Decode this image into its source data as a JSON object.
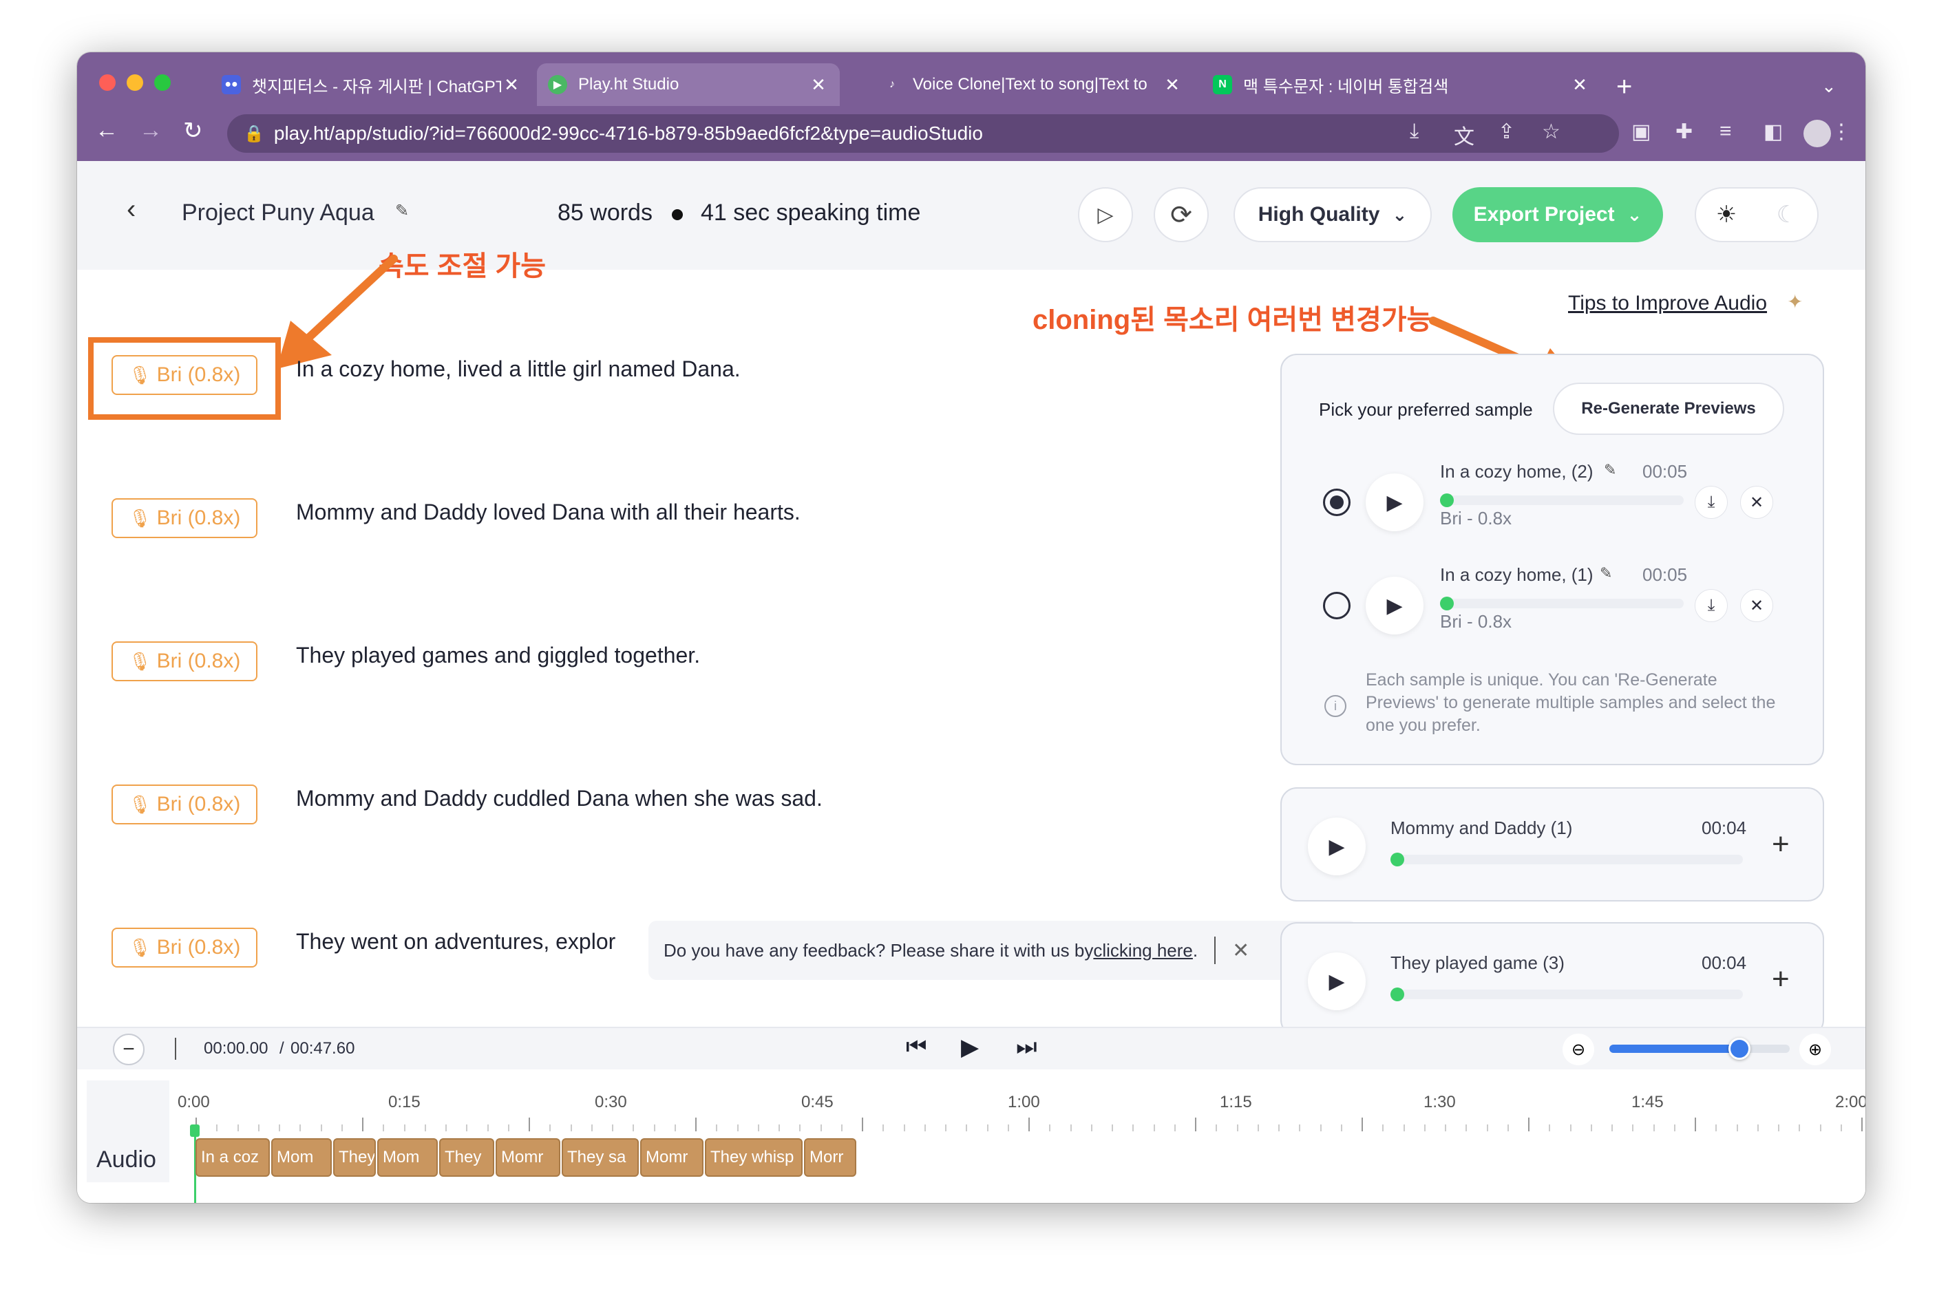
{
  "browser": {
    "tabs": [
      {
        "label": "챗지피터스 - 자유 게시판 | ChatGPT"
      },
      {
        "label": "Play.ht Studio"
      },
      {
        "label": "Voice Clone|Text to song|Text to"
      },
      {
        "label": "맥 특수문자 : 네이버 통합검색"
      }
    ],
    "url": "play.ht/app/studio/?id=766000d2-99cc-4716-b879-85b9aed6fcf2&type=audioStudio"
  },
  "header": {
    "project_name": "Project Puny Aqua",
    "word_count": "85 words",
    "speaking_time": "41 sec speaking time",
    "quality_label": "High Quality",
    "export_label": "Export Project"
  },
  "annotations": {
    "speed": "속도 조절 가능",
    "cloning": "cloning된 목소리 여러번 변경가능"
  },
  "tips_link": "Tips to Improve Audio",
  "paragraphs": [
    {
      "voice": "Bri (0.8x)",
      "text": "In a cozy home, lived a little girl named Dana."
    },
    {
      "voice": "Bri (0.8x)",
      "text": "Mommy and Daddy loved Dana with all their hearts."
    },
    {
      "voice": "Bri (0.8x)",
      "text": "They played games and giggled together."
    },
    {
      "voice": "Bri (0.8x)",
      "text": "Mommy and Daddy cuddled Dana when she was sad."
    },
    {
      "voice": "Bri (0.8x)",
      "text": "They went on adventures, explor"
    }
  ],
  "feedback": {
    "text": "Do you have any feedback? Please share it with us by ",
    "link": "clicking here",
    "end": "."
  },
  "preview_panel": {
    "heading": "Pick your preferred sample",
    "regenerate_label": "Re-Generate Previews",
    "samples": [
      {
        "title": "In a cozy home, (2)",
        "duration": "00:05",
        "voice": "Bri - 0.8x",
        "selected": true
      },
      {
        "title": "In a cozy home, (1)",
        "duration": "00:05",
        "voice": "Bri - 0.8x",
        "selected": false
      }
    ],
    "info": "Each sample is unique. You can 'Re-Generate Previews' to generate multiple samples and select the one you prefer."
  },
  "other_previews": [
    {
      "title": "Mommy and Daddy (1)",
      "duration": "00:04"
    },
    {
      "title": "They played game (3)",
      "duration": "00:04"
    }
  ],
  "player": {
    "current": "00:00.00",
    "separator": "/",
    "total": "00:47.60",
    "zoom_level": 0.72
  },
  "timeline": {
    "ticks": [
      "0:00",
      "0:15",
      "0:30",
      "0:45",
      "1:00",
      "1:15",
      "1:30",
      "1:45",
      "2:00"
    ],
    "track_label": "Audio",
    "clips": [
      "In a coz",
      "Mom",
      "They",
      "Mom",
      "They ",
      "Momr",
      "They sa",
      "Momr",
      "They whisp",
      "Morr"
    ]
  },
  "colors": {
    "chrome": "#7b5d96",
    "export_green": "#58d487",
    "voice_orange": "#f0a24c",
    "annotation_orange": "#ee7a2c",
    "annotation_red": "#ee5a2a"
  }
}
